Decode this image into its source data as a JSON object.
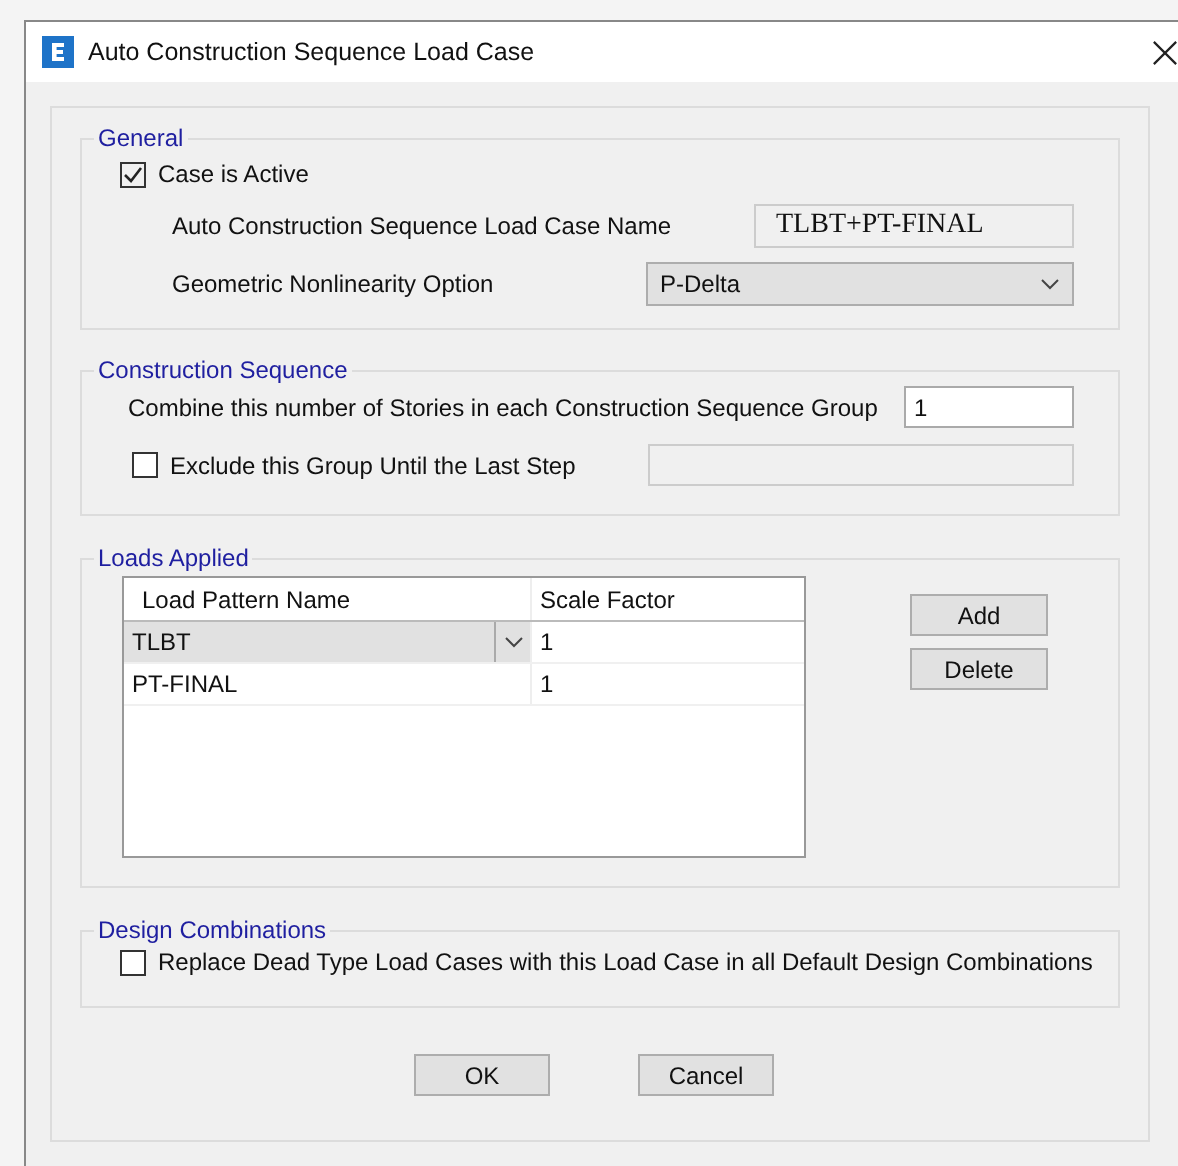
{
  "window": {
    "title": "Auto Construction Sequence Load Case"
  },
  "general": {
    "legend": "General",
    "case_active": {
      "label": "Case is Active",
      "checked": true
    },
    "name_label": "Auto Construction Sequence Load Case Name",
    "name_value": "TLBT+PT-FINAL",
    "nonlinearity_label": "Geometric Nonlinearity Option",
    "nonlinearity_value": "P-Delta"
  },
  "construction_sequence": {
    "legend": "Construction Sequence",
    "combine_label": "Combine this number of Stories in each Construction Sequence Group",
    "combine_value": "1",
    "exclude": {
      "label": "Exclude this Group Until the Last Step",
      "checked": false
    }
  },
  "loads_applied": {
    "legend": "Loads Applied",
    "columns": [
      "Load Pattern Name",
      "Scale Factor"
    ],
    "rows": [
      {
        "pattern": "TLBT",
        "scale": "1",
        "selected": true
      },
      {
        "pattern": "PT-FINAL",
        "scale": "1",
        "selected": false
      }
    ],
    "buttons": [
      "Add",
      "Delete"
    ]
  },
  "design_combinations": {
    "legend": "Design Combinations",
    "replace": {
      "label": "Replace Dead Type Load Cases with this Load Case in all Default Design Combinations",
      "checked": false
    }
  },
  "buttons": [
    "OK",
    "Cancel"
  ]
}
